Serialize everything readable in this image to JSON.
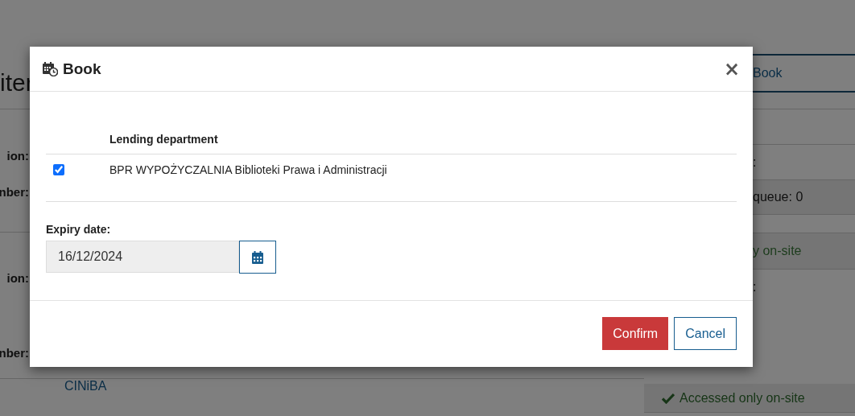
{
  "background": {
    "heading": "iter",
    "left_labels": [
      "ion:",
      "nber:",
      "ion:",
      "nber:"
    ],
    "link": "CINiBA",
    "book_button": "Book",
    "fragments": [
      ":",
      ":"
    ],
    "queue": "queue: 0",
    "onsite_partial": "y on-site",
    "accessed": "Accessed only on-site"
  },
  "dialog": {
    "title": "Book",
    "close": "×",
    "table": {
      "columns": [
        "Lending department"
      ],
      "rows": [
        {
          "checked": true,
          "department": "BPR WYPOŻYCZALNIA Biblioteki Prawa i Administracji"
        }
      ]
    },
    "expiry": {
      "label": "Expiry date:",
      "value": "16/12/2024"
    },
    "buttons": [
      {
        "label": "Confirm",
        "kind": "primary"
      },
      {
        "label": "Cancel",
        "kind": "secondary"
      }
    ]
  }
}
